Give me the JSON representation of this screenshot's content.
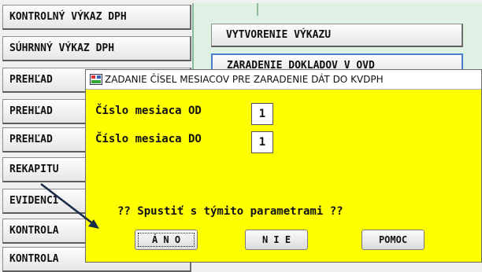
{
  "left_menu": [
    "KONTROLNÝ VÝKAZ DPH",
    "SÚHRNNÝ VÝKAZ DPH",
    "PREHĽAD",
    "PREHĽAD",
    "PREHĽAD",
    "REKAPITU",
    "EVIDENCI",
    "KONTROLA",
    "KONTROLA"
  ],
  "right_panel": {
    "create_report": "VYTVORENIE VÝKAZU",
    "assign_documents": "ZARADENIE DOKLADOV V OVD"
  },
  "dialog": {
    "title": "ZADANIE ČÍSEL MESIACOV PRE  ZARADENIE DÁT DO KVDPH",
    "month_from_label": "Číslo mesiaca OD",
    "month_from_value": "1",
    "month_to_label": "Číslo mesiaca DO",
    "month_to_value": "1",
    "question": "?? Spustiť s týmito parametrami ??",
    "yes_label": "Á N O",
    "no_label": "N I E",
    "help_label": "POMOC"
  },
  "colors": {
    "dialog_bg": "#ffff00",
    "panel_bg": "#dff0e4",
    "arrow": "#1a2a4a"
  }
}
